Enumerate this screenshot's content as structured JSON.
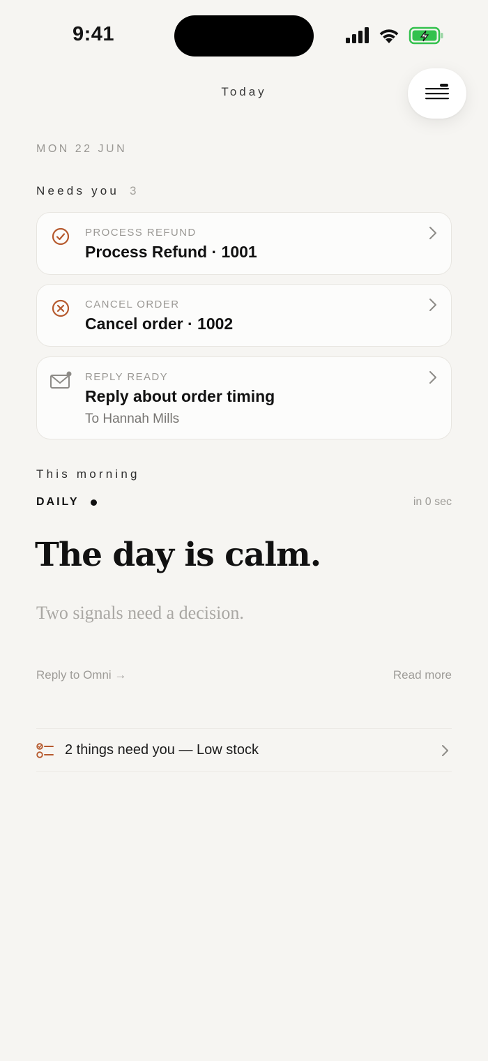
{
  "status_bar": {
    "time": "9:41"
  },
  "header": {
    "title": "Today",
    "menu_icon": "menu-icon"
  },
  "date": "MON 22 JUN",
  "needs_you": {
    "label": "Needs you",
    "count": "3",
    "items": [
      {
        "kicker": "PROCESS REFUND",
        "title": "Process Refund · 1001",
        "icon": "check-circle-icon"
      },
      {
        "kicker": "CANCEL ORDER",
        "title": "Cancel order · 1002",
        "icon": "x-circle-icon"
      },
      {
        "kicker": "REPLY READY",
        "title": "Reply about order timing",
        "subtitle": "To Hannah Mills",
        "icon": "mail-icon"
      }
    ]
  },
  "this_morning": {
    "label": "This morning",
    "daily_label": "DAILY",
    "time": "in 0 sec",
    "headline": "The day is calm.",
    "subline": "Two signals need a decision.",
    "reply_link": "Reply to Omni →",
    "read_more": "Read more"
  },
  "summary": {
    "text": "2 things need you — Low stock",
    "icon": "checklist-icon"
  },
  "colors": {
    "accent": "#b65a2e",
    "background": "#f6f5f2",
    "battery": "#33c14d"
  }
}
